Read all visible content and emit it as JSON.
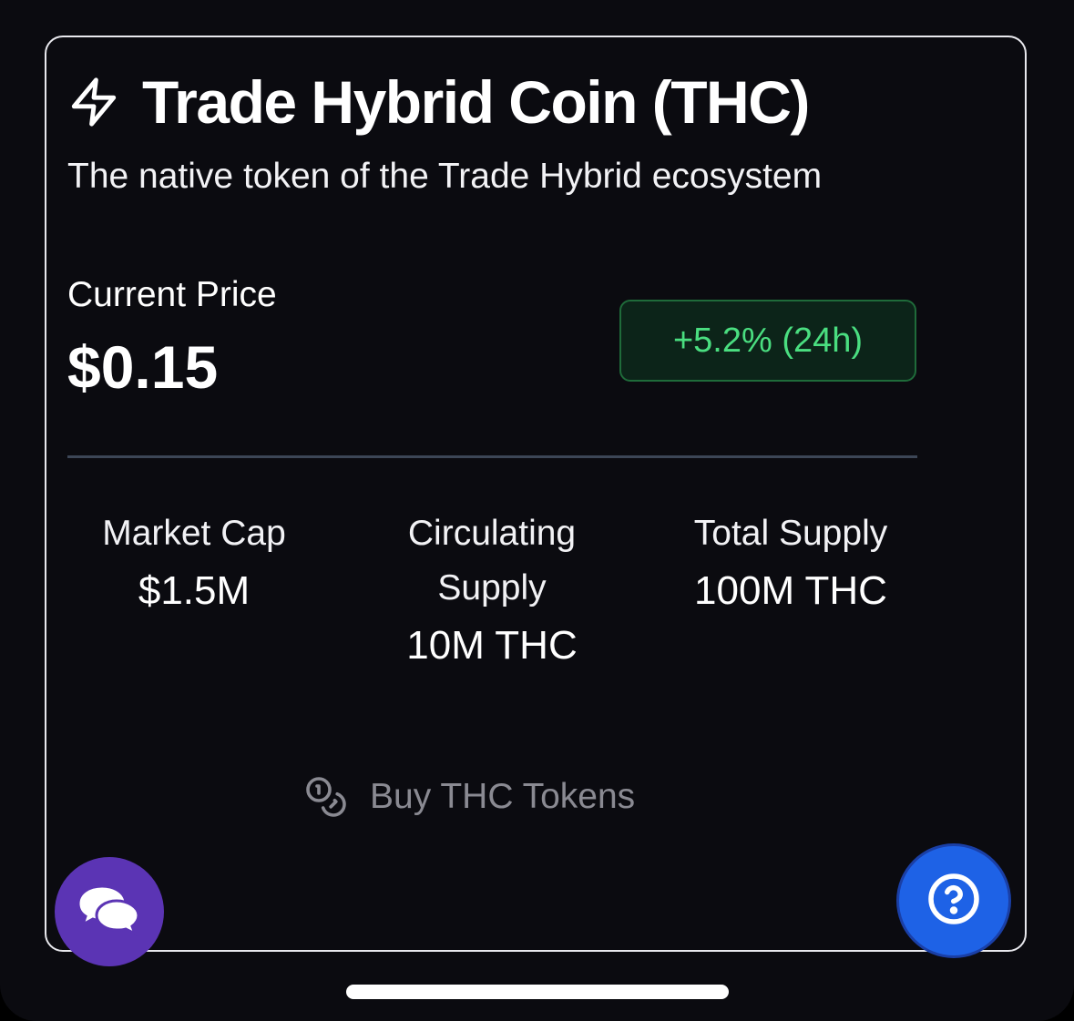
{
  "card": {
    "icon": "lightning-bolt-icon",
    "title": "Trade Hybrid Coin (THC)",
    "subtitle": "The native token of the Trade Hybrid ecosystem"
  },
  "price": {
    "label": "Current Price",
    "value": "$0.15",
    "change": "+5.2% (24h)"
  },
  "stats": [
    {
      "label": "Market Cap",
      "value": "$1.5M"
    },
    {
      "label_line1": "Circulating",
      "label_line2": "Supply",
      "value": "10M THC"
    },
    {
      "label": "Total Supply",
      "value": "100M THC"
    }
  ],
  "buy_button": {
    "icon": "coins-icon",
    "label": "Buy THC Tokens"
  },
  "fabs": {
    "chat_icon": "chat-bubbles-icon",
    "help_icon": "question-circle-icon"
  },
  "colors": {
    "background": "#0b0b10",
    "card_border": "#e9e9ee",
    "positive": "#4ade80",
    "positive_badge_bg": "#0c2419",
    "chat_fab": "#5b34b4",
    "help_fab": "#1e62e6",
    "muted_text": "#8a8a92"
  }
}
